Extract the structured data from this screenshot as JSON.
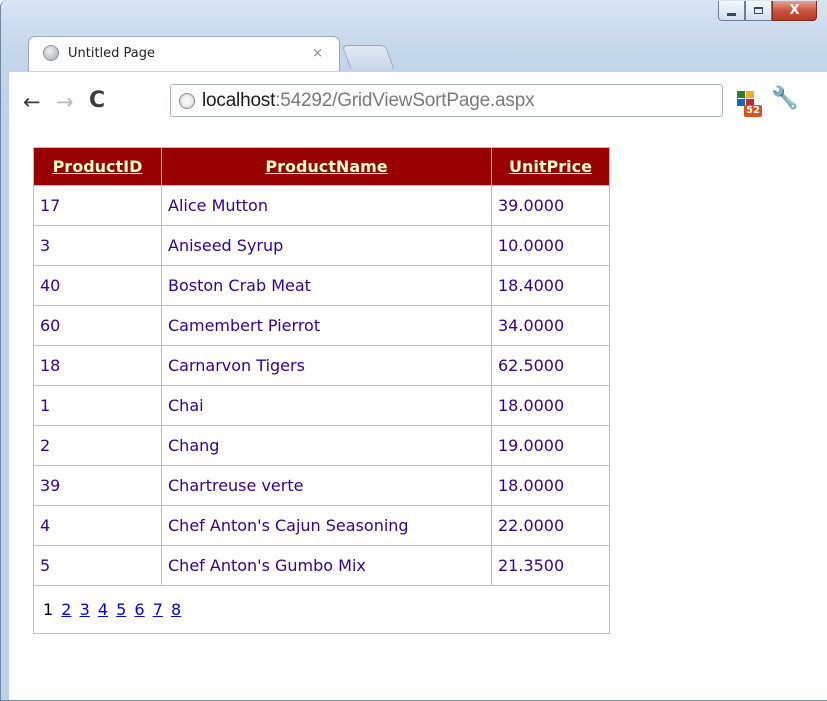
{
  "window": {
    "caption_buttons": {
      "minimize": "minimize-icon",
      "maximize": "maximize-icon",
      "close": "X"
    }
  },
  "tabs": [
    {
      "title": "Untitled Page",
      "close": "×",
      "icon": "globe-icon"
    }
  ],
  "toolbar": {
    "back": "←",
    "forward": "→",
    "reload": "C",
    "url_host": "localhost",
    "url_rest": ":54292/GridViewSortPage.aspx",
    "extension_badge": "52",
    "wrench": "🔧"
  },
  "grid": {
    "colors": {
      "header_bg": "#990000",
      "header_fg": "#ffffcc",
      "cell_fg": "#330099",
      "border": "#deba84"
    },
    "headers": [
      "ProductID",
      "ProductName",
      "UnitPrice"
    ],
    "rows": [
      [
        "17",
        "Alice Mutton",
        "39.0000"
      ],
      [
        "3",
        "Aniseed Syrup",
        "10.0000"
      ],
      [
        "40",
        "Boston Crab Meat",
        "18.4000"
      ],
      [
        "60",
        "Camembert Pierrot",
        "34.0000"
      ],
      [
        "18",
        "Carnarvon Tigers",
        "62.5000"
      ],
      [
        "1",
        "Chai",
        "18.0000"
      ],
      [
        "2",
        "Chang",
        "19.0000"
      ],
      [
        "39",
        "Chartreuse verte",
        "18.0000"
      ],
      [
        "4",
        "Chef Anton's Cajun Seasoning",
        "22.0000"
      ],
      [
        "5",
        "Chef Anton's Gumbo Mix",
        "21.3500"
      ]
    ],
    "pager": {
      "current": "1",
      "pages": [
        "2",
        "3",
        "4",
        "5",
        "6",
        "7",
        "8"
      ]
    }
  }
}
